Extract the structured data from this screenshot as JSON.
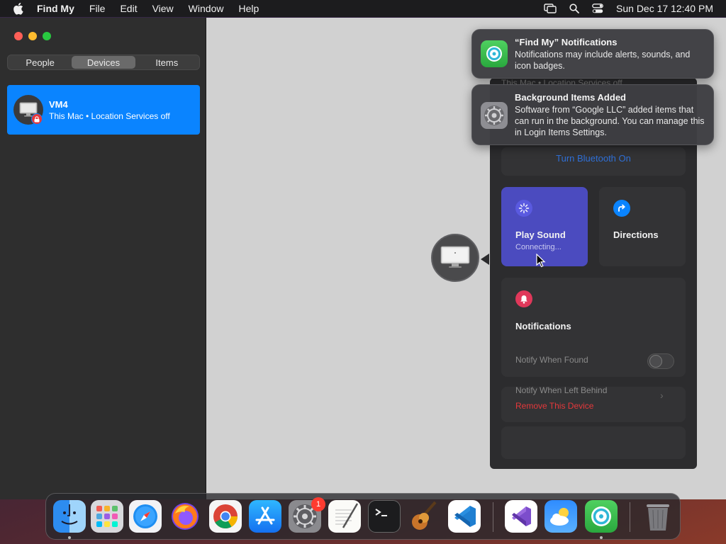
{
  "menubar": {
    "app_name": "Find My",
    "items": [
      "File",
      "Edit",
      "View",
      "Window",
      "Help"
    ],
    "clock": "Sun Dec 17  12:40 PM"
  },
  "sidebar": {
    "tabs": [
      "People",
      "Devices",
      "Items"
    ],
    "active_tab": "Devices",
    "device": {
      "name": "VM4",
      "subtitle": "This Mac • Location Services off"
    }
  },
  "panel": {
    "hidden_subtitle": "This Mac • Location Services off",
    "bluetooth_link": "Turn Bluetooth On",
    "actions": [
      {
        "label": "Play Sound",
        "sub": "Connecting..."
      },
      {
        "label": "Directions",
        "sub": ""
      }
    ],
    "notifications_title": "Notifications",
    "notify_when_found": "Notify When Found",
    "notify_when_left_behind": "Notify When Left Behind",
    "remove_device": "Remove This Device"
  },
  "banners": [
    {
      "title": "“Find My” Notifications",
      "body": "Notifications may include alerts, sounds, and icon badges."
    },
    {
      "title": "Background Items Added",
      "body": "Software from “Google LLC” added items that can run in the background. You can manage this in Login Items Settings."
    }
  ],
  "dock": {
    "apps": [
      "finder",
      "launchpad",
      "safari",
      "firefox",
      "chrome",
      "app-store",
      "system-settings",
      "textedit",
      "terminal",
      "garageband",
      "vscode",
      "visual-studio",
      "weather",
      "find-my",
      "trash"
    ],
    "settings_badge": "1"
  },
  "colors": {
    "accent": "#0a84ff",
    "destructive": "#e5383b",
    "active_action": "#4b4bbf"
  }
}
